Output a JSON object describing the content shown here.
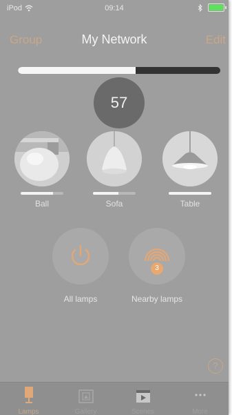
{
  "status_bar": {
    "carrier": "iPod",
    "time": "09:14"
  },
  "nav": {
    "left": "Group",
    "title": "My Network",
    "right": "Edit"
  },
  "brightness": {
    "value": "57",
    "fraction": 0.58
  },
  "lamps": [
    {
      "name": "Ball",
      "level": 0.75
    },
    {
      "name": "Sofa",
      "level": 0.6
    },
    {
      "name": "Table",
      "level": 1.0
    }
  ],
  "actions": {
    "all_lamps": {
      "label": "All lamps"
    },
    "nearby_lamps": {
      "label": "Nearby lamps",
      "badge": "3"
    }
  },
  "help": {
    "icon_text": "?"
  },
  "tabs": [
    {
      "label": "Lamps",
      "icon": "lamp-icon",
      "active": true
    },
    {
      "label": "Gallery",
      "icon": "gallery-icon",
      "active": false
    },
    {
      "label": "Scenes",
      "icon": "scenes-icon",
      "active": false
    },
    {
      "label": "More",
      "icon": "more-icon",
      "active": false
    }
  ],
  "colors": {
    "accent": "#c8a888",
    "background": "#9e9e9e",
    "badge": "#e8a870",
    "battery": "#5be35b"
  }
}
